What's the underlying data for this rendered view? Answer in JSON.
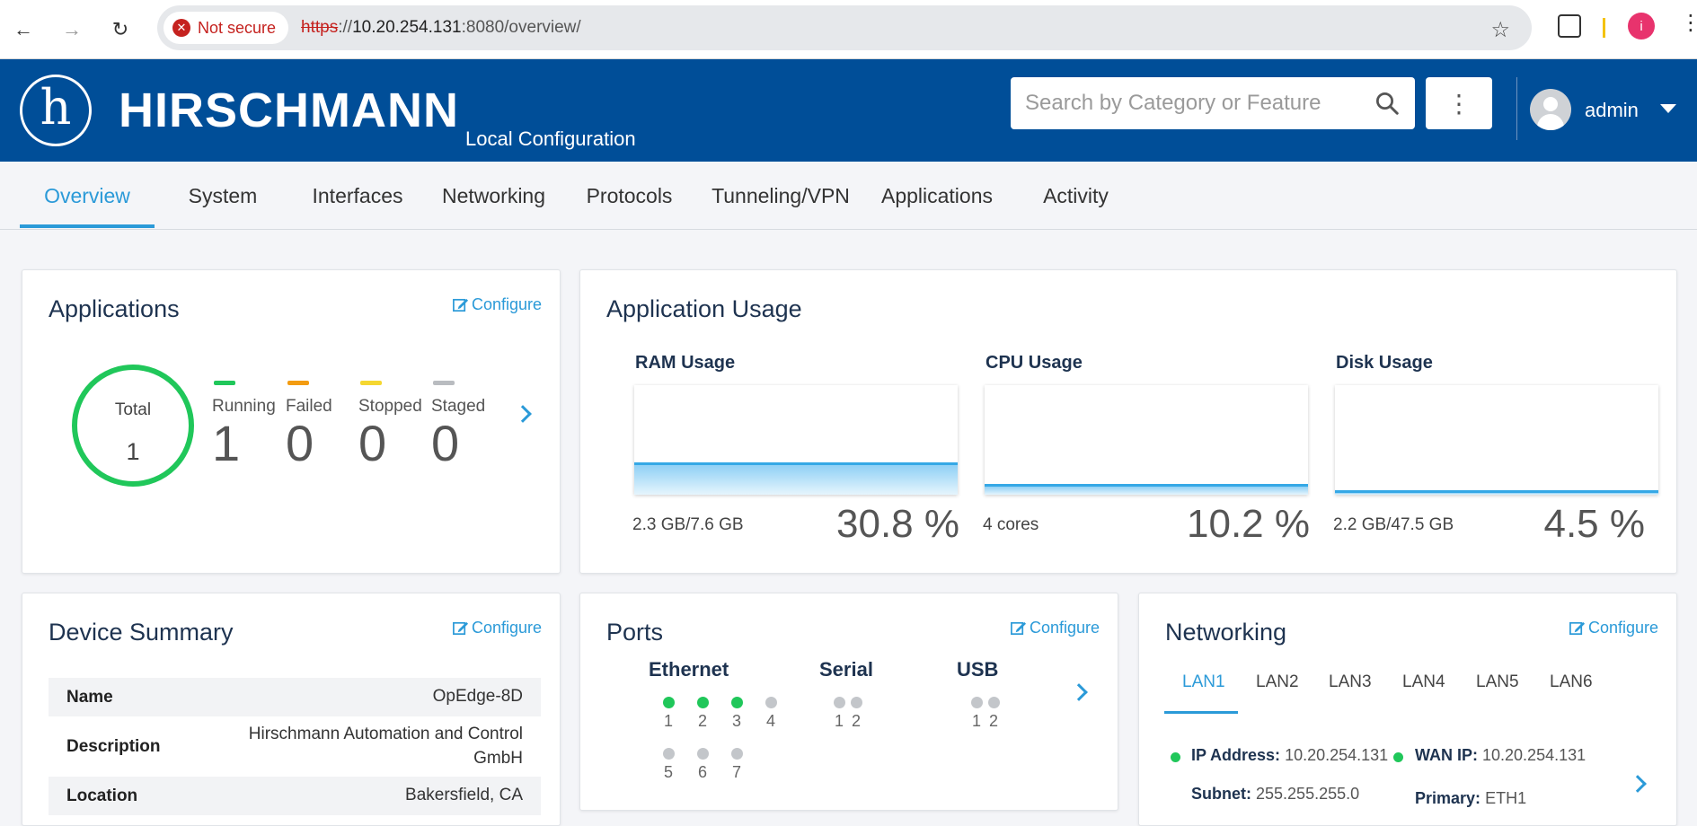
{
  "browser": {
    "security_label": "Not secure",
    "url_scheme": "https",
    "url_rest": "://",
    "url_host": "10.20.254.131",
    "url_path": ":8080/overview/",
    "profile_initial": "i"
  },
  "header": {
    "brand": "HIRSCHMANN",
    "subtitle": "Local Configuration",
    "search_placeholder": "Search by Category or Feature",
    "user": "admin"
  },
  "tabs": [
    {
      "label": "Overview",
      "active": true
    },
    {
      "label": "System"
    },
    {
      "label": "Interfaces"
    },
    {
      "label": "Networking"
    },
    {
      "label": "Protocols"
    },
    {
      "label": "Tunneling/VPN"
    },
    {
      "label": "Applications"
    },
    {
      "label": "Activity"
    }
  ],
  "applications": {
    "title": "Applications",
    "configure": "Configure",
    "total_label": "Total",
    "total_value": "1",
    "stats": [
      {
        "label": "Running",
        "value": "1",
        "color": "#20c75a"
      },
      {
        "label": "Failed",
        "value": "0",
        "color": "#f39c12"
      },
      {
        "label": "Stopped",
        "value": "0",
        "color": "#f5d731"
      },
      {
        "label": "Staged",
        "value": "0",
        "color": "#b9bcc0"
      }
    ]
  },
  "usage": {
    "title": "Application Usage",
    "ram": {
      "label": "RAM Usage",
      "sub": "2.3 GB/7.6 GB",
      "pct": "30.8 %",
      "level": 0.308
    },
    "cpu": {
      "label": "CPU Usage",
      "sub": "4 cores",
      "pct": "10.2 %",
      "level": 0.102
    },
    "disk": {
      "label": "Disk Usage",
      "sub": "2.2 GB/47.5 GB",
      "pct": "4.5 %",
      "level": 0.045
    }
  },
  "device": {
    "title": "Device Summary",
    "configure": "Configure",
    "rows": [
      {
        "key": "Name",
        "value": "OpEdge-8D"
      },
      {
        "key": "Description",
        "value": "Hirschmann Automation and Control GmbH"
      },
      {
        "key": "Location",
        "value": "Bakersfield, CA"
      }
    ]
  },
  "ports": {
    "title": "Ports",
    "configure": "Configure",
    "ethernet": {
      "label": "Ethernet",
      "ports": [
        {
          "n": "1",
          "up": true
        },
        {
          "n": "2",
          "up": true
        },
        {
          "n": "3",
          "up": true
        },
        {
          "n": "4",
          "up": false
        },
        {
          "n": "5",
          "up": false
        },
        {
          "n": "6",
          "up": false
        },
        {
          "n": "7",
          "up": false
        }
      ]
    },
    "serial": {
      "label": "Serial",
      "ports": [
        {
          "n": "1",
          "up": false
        },
        {
          "n": "2",
          "up": false
        }
      ]
    },
    "usb": {
      "label": "USB",
      "ports": [
        {
          "n": "1",
          "up": false
        },
        {
          "n": "2",
          "up": false
        }
      ]
    },
    "up_color": "#20c75a",
    "down_color": "#c3c6ca"
  },
  "networking": {
    "title": "Networking",
    "configure": "Configure",
    "lans": [
      "LAN1",
      "LAN2",
      "LAN3",
      "LAN4",
      "LAN5",
      "LAN6"
    ],
    "ip_label": "IP Address:",
    "ip_value": "10.20.254.131",
    "subnet_label": "Subnet:",
    "subnet_value": "255.255.255.0",
    "wan_label": "WAN IP:",
    "wan_value": "10.20.254.131",
    "primary_label": "Primary:",
    "primary_value": "ETH1"
  }
}
